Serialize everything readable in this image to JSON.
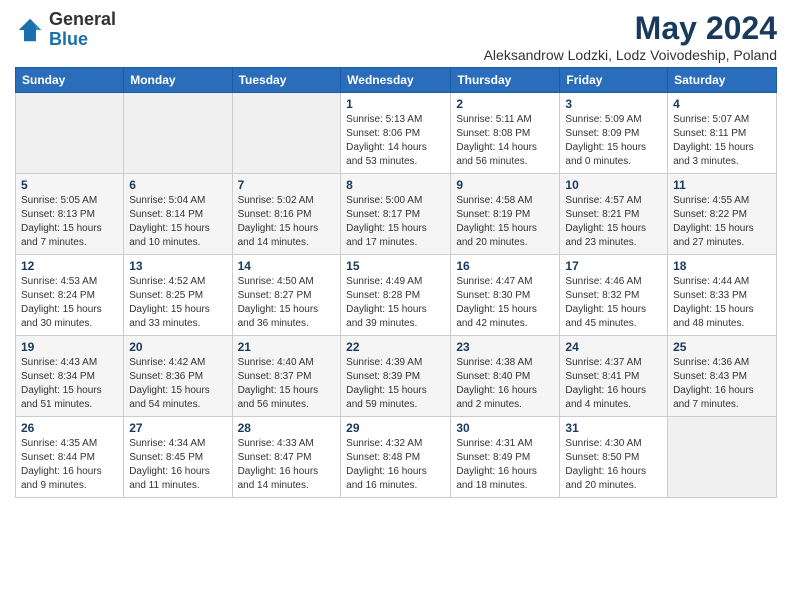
{
  "header": {
    "logo_general": "General",
    "logo_blue": "Blue",
    "title": "May 2024",
    "subtitle": "Aleksandrow Lodzki, Lodz Voivodeship, Poland"
  },
  "weekdays": [
    "Sunday",
    "Monday",
    "Tuesday",
    "Wednesday",
    "Thursday",
    "Friday",
    "Saturday"
  ],
  "weeks": [
    [
      {
        "day": "",
        "info": ""
      },
      {
        "day": "",
        "info": ""
      },
      {
        "day": "",
        "info": ""
      },
      {
        "day": "1",
        "info": "Sunrise: 5:13 AM\nSunset: 8:06 PM\nDaylight: 14 hours and 53 minutes."
      },
      {
        "day": "2",
        "info": "Sunrise: 5:11 AM\nSunset: 8:08 PM\nDaylight: 14 hours and 56 minutes."
      },
      {
        "day": "3",
        "info": "Sunrise: 5:09 AM\nSunset: 8:09 PM\nDaylight: 15 hours and 0 minutes."
      },
      {
        "day": "4",
        "info": "Sunrise: 5:07 AM\nSunset: 8:11 PM\nDaylight: 15 hours and 3 minutes."
      }
    ],
    [
      {
        "day": "5",
        "info": "Sunrise: 5:05 AM\nSunset: 8:13 PM\nDaylight: 15 hours and 7 minutes."
      },
      {
        "day": "6",
        "info": "Sunrise: 5:04 AM\nSunset: 8:14 PM\nDaylight: 15 hours and 10 minutes."
      },
      {
        "day": "7",
        "info": "Sunrise: 5:02 AM\nSunset: 8:16 PM\nDaylight: 15 hours and 14 minutes."
      },
      {
        "day": "8",
        "info": "Sunrise: 5:00 AM\nSunset: 8:17 PM\nDaylight: 15 hours and 17 minutes."
      },
      {
        "day": "9",
        "info": "Sunrise: 4:58 AM\nSunset: 8:19 PM\nDaylight: 15 hours and 20 minutes."
      },
      {
        "day": "10",
        "info": "Sunrise: 4:57 AM\nSunset: 8:21 PM\nDaylight: 15 hours and 23 minutes."
      },
      {
        "day": "11",
        "info": "Sunrise: 4:55 AM\nSunset: 8:22 PM\nDaylight: 15 hours and 27 minutes."
      }
    ],
    [
      {
        "day": "12",
        "info": "Sunrise: 4:53 AM\nSunset: 8:24 PM\nDaylight: 15 hours and 30 minutes."
      },
      {
        "day": "13",
        "info": "Sunrise: 4:52 AM\nSunset: 8:25 PM\nDaylight: 15 hours and 33 minutes."
      },
      {
        "day": "14",
        "info": "Sunrise: 4:50 AM\nSunset: 8:27 PM\nDaylight: 15 hours and 36 minutes."
      },
      {
        "day": "15",
        "info": "Sunrise: 4:49 AM\nSunset: 8:28 PM\nDaylight: 15 hours and 39 minutes."
      },
      {
        "day": "16",
        "info": "Sunrise: 4:47 AM\nSunset: 8:30 PM\nDaylight: 15 hours and 42 minutes."
      },
      {
        "day": "17",
        "info": "Sunrise: 4:46 AM\nSunset: 8:32 PM\nDaylight: 15 hours and 45 minutes."
      },
      {
        "day": "18",
        "info": "Sunrise: 4:44 AM\nSunset: 8:33 PM\nDaylight: 15 hours and 48 minutes."
      }
    ],
    [
      {
        "day": "19",
        "info": "Sunrise: 4:43 AM\nSunset: 8:34 PM\nDaylight: 15 hours and 51 minutes."
      },
      {
        "day": "20",
        "info": "Sunrise: 4:42 AM\nSunset: 8:36 PM\nDaylight: 15 hours and 54 minutes."
      },
      {
        "day": "21",
        "info": "Sunrise: 4:40 AM\nSunset: 8:37 PM\nDaylight: 15 hours and 56 minutes."
      },
      {
        "day": "22",
        "info": "Sunrise: 4:39 AM\nSunset: 8:39 PM\nDaylight: 15 hours and 59 minutes."
      },
      {
        "day": "23",
        "info": "Sunrise: 4:38 AM\nSunset: 8:40 PM\nDaylight: 16 hours and 2 minutes."
      },
      {
        "day": "24",
        "info": "Sunrise: 4:37 AM\nSunset: 8:41 PM\nDaylight: 16 hours and 4 minutes."
      },
      {
        "day": "25",
        "info": "Sunrise: 4:36 AM\nSunset: 8:43 PM\nDaylight: 16 hours and 7 minutes."
      }
    ],
    [
      {
        "day": "26",
        "info": "Sunrise: 4:35 AM\nSunset: 8:44 PM\nDaylight: 16 hours and 9 minutes."
      },
      {
        "day": "27",
        "info": "Sunrise: 4:34 AM\nSunset: 8:45 PM\nDaylight: 16 hours and 11 minutes."
      },
      {
        "day": "28",
        "info": "Sunrise: 4:33 AM\nSunset: 8:47 PM\nDaylight: 16 hours and 14 minutes."
      },
      {
        "day": "29",
        "info": "Sunrise: 4:32 AM\nSunset: 8:48 PM\nDaylight: 16 hours and 16 minutes."
      },
      {
        "day": "30",
        "info": "Sunrise: 4:31 AM\nSunset: 8:49 PM\nDaylight: 16 hours and 18 minutes."
      },
      {
        "day": "31",
        "info": "Sunrise: 4:30 AM\nSunset: 8:50 PM\nDaylight: 16 hours and 20 minutes."
      },
      {
        "day": "",
        "info": ""
      }
    ]
  ]
}
